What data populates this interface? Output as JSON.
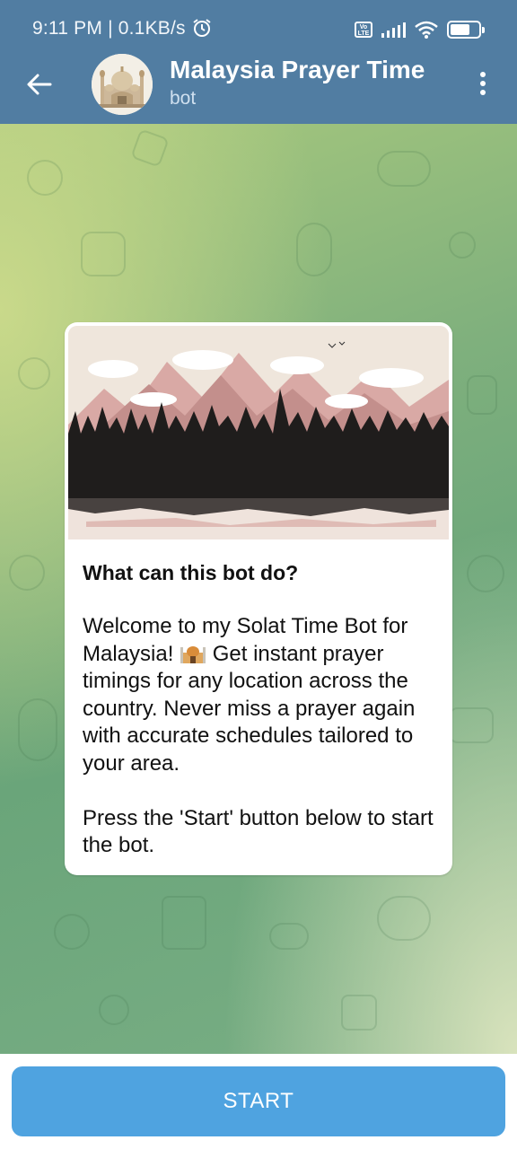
{
  "status_bar": {
    "time": "9:11 PM | 0.1KB/s",
    "volte_label": "Vo LTE",
    "battery_level": 0.7
  },
  "header": {
    "title": "Malaysia Prayer Time",
    "subtitle": "bot"
  },
  "card": {
    "heading": "What can this bot do?",
    "body_part1": "Welcome to my Solat Time Bot for Malaysia! ",
    "body_part2": " Get instant prayer timings for any location across the country. Never miss a prayer again with accurate schedules tailored to your area.\n\nPress the 'Start' button below to start the bot."
  },
  "bottom": {
    "start_label": "START"
  },
  "colors": {
    "header": "#517da2",
    "start_button": "#4fa3e0"
  }
}
